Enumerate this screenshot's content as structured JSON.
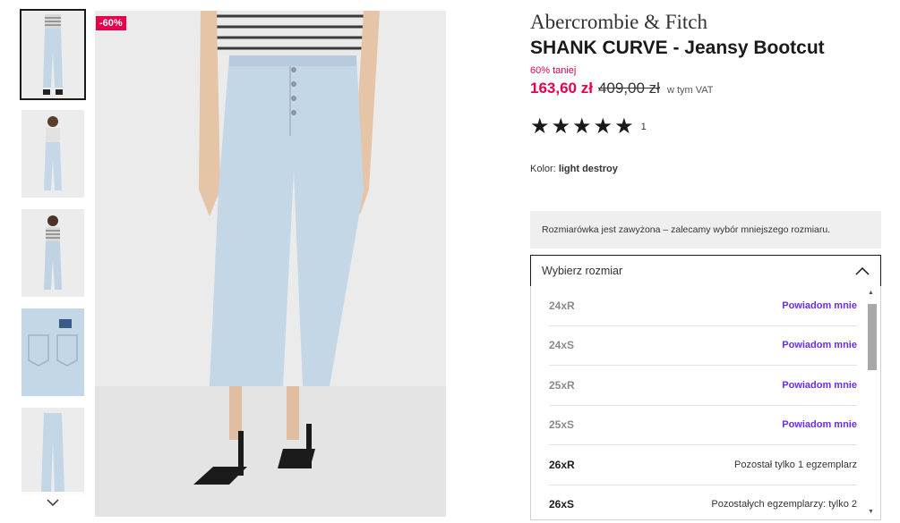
{
  "thumbnails": [
    {
      "name": "thumb-front-full",
      "active": true
    },
    {
      "name": "thumb-model-sunglasses"
    },
    {
      "name": "thumb-back-full"
    },
    {
      "name": "thumb-back-pocket"
    },
    {
      "name": "thumb-flat-jeans"
    }
  ],
  "badge": "-60%",
  "product": {
    "brand": "Abercrombie & Fitch",
    "title": "SHANK CURVE - Jeansy Bootcut",
    "discount_text": "60% taniej",
    "price": "163,60 zł",
    "old_price": "409,00 zł",
    "vat": "w tym VAT",
    "rating_stars": 5,
    "rating_count": "1",
    "color_label": "Kolor:",
    "color_value": "light destroy"
  },
  "size_notice": "Rozmiarówka jest zawyżona – zalecamy wybór mniejszego rozmiaru.",
  "size_select": {
    "placeholder": "Wybierz rozmiar",
    "options": [
      {
        "size": "24xR",
        "action": "Powiadom mnie",
        "available": false
      },
      {
        "size": "24xS",
        "action": "Powiadom mnie",
        "available": false
      },
      {
        "size": "25xR",
        "action": "Powiadom mnie",
        "available": false
      },
      {
        "size": "25xS",
        "action": "Powiadom mnie",
        "available": false
      },
      {
        "size": "26xR",
        "stock": "Pozostał tylko 1 egzemplarz",
        "available": true
      },
      {
        "size": "26xS",
        "stock": "Pozostałych egzemplarzy: tylko 2",
        "available": true
      }
    ]
  },
  "colors": {
    "accent": "#e6004c",
    "notify": "#6a2ee8",
    "text": "#1a1a1a"
  }
}
